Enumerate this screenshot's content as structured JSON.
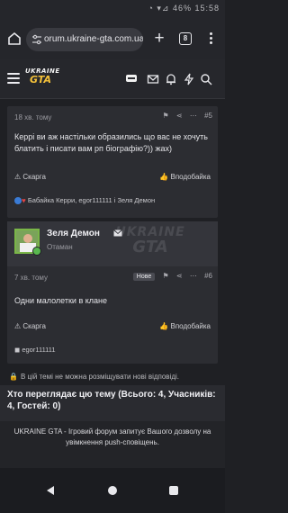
{
  "status_bar": {
    "icons": "◔ ▾⊿ 46% 15:58"
  },
  "browser": {
    "url": "orum.ukraine-gta.com.ua",
    "tab_count": "8"
  },
  "site": {
    "logo_top": "UKRAINE",
    "logo_bottom": "GTA"
  },
  "post1": {
    "time": "18 хв. тому",
    "number": "#5",
    "text": "Керрі ви аж настільки образились що вас не хочуть блатить і писати вам рп біографію?)) жах)",
    "report": "Скарга",
    "like": "Вподобайка",
    "reactions": "Бабайка Керри, egor111111 і Зеля Демон"
  },
  "post2": {
    "author": "Зеля Демон",
    "role": "Отаман",
    "time": "7 хв. тому",
    "badge": "Нове",
    "number": "#6",
    "text": "Одни малолетки в клане",
    "report": "Скарга",
    "like": "Вподобайка",
    "reacted_by": "egor111111",
    "watermark_top": "UKRAINE",
    "watermark_bottom": "GTA"
  },
  "notice": "В цій темі не можна розміщувати нові відповіді.",
  "watchers": "Хто переглядає цю тему (Всього: 4, Учасників: 4, Гостей: 0)",
  "push_banner": "UKRAINE GTA - Ігровий форум запитує Вашого дозволу на увімкнення push-сповіщень."
}
